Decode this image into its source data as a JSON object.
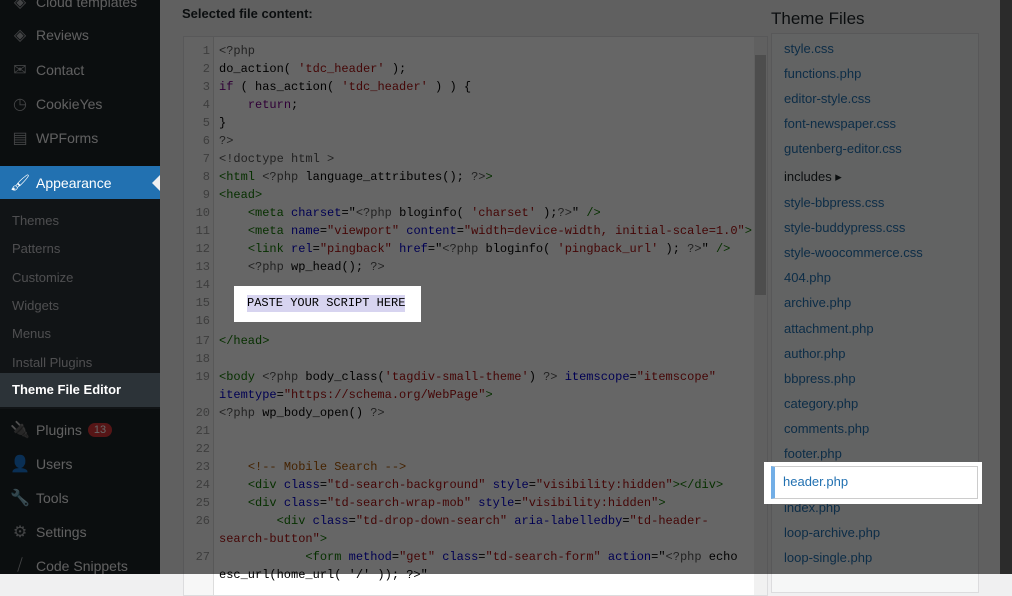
{
  "sidebar": {
    "items": [
      {
        "label": "Cloud templates",
        "icon": "cloud-templates-icon",
        "glyph": "◈"
      },
      {
        "label": "Reviews",
        "icon": "reviews-icon",
        "glyph": "◈"
      },
      {
        "label": "Contact",
        "icon": "mail-icon",
        "glyph": "✉"
      },
      {
        "label": "CookieYes",
        "icon": "cookie-icon",
        "glyph": "◷"
      },
      {
        "label": "WPForms",
        "icon": "forms-icon",
        "glyph": "▤"
      }
    ],
    "appearance": {
      "label": "Appearance",
      "glyph": "🖌"
    },
    "submenu": [
      "Themes",
      "Patterns",
      "Customize",
      "Widgets",
      "Menus",
      "Install Plugins"
    ],
    "active_sub": "Theme File Editor",
    "bottom": [
      {
        "label": "Plugins",
        "icon": "plugins-icon",
        "glyph": "🔌",
        "badge": "13"
      },
      {
        "label": "Users",
        "icon": "users-icon",
        "glyph": "👤"
      },
      {
        "label": "Tools",
        "icon": "tools-icon",
        "glyph": "🔧"
      },
      {
        "label": "Settings",
        "icon": "settings-icon",
        "glyph": "⚙"
      },
      {
        "label": "Code Snippets",
        "icon": "code-snippets-icon",
        "glyph": "⧸"
      }
    ]
  },
  "editor": {
    "label": "Selected file content:",
    "highlight": "PASTE YOUR SCRIPT HERE",
    "lines": [
      [
        [
          "<?php",
          "meta"
        ]
      ],
      [
        [
          "do_action( ",
          ""
        ],
        [
          "'tdc_header'",
          "str"
        ],
        [
          " );",
          ""
        ]
      ],
      [
        [
          "if",
          "kw"
        ],
        [
          " ( has_action( ",
          ""
        ],
        [
          "'tdc_header'",
          "str"
        ],
        [
          " ) ) {",
          ""
        ]
      ],
      [
        [
          "    ",
          ""
        ],
        [
          "return",
          "kw"
        ],
        [
          ";",
          ""
        ]
      ],
      [
        [
          "}",
          ""
        ]
      ],
      [
        [
          "?>",
          "meta"
        ]
      ],
      [
        [
          "<!doctype html >",
          "meta"
        ]
      ],
      [
        [
          "<html ",
          "tag"
        ],
        [
          "<?php",
          "meta"
        ],
        [
          " language_attributes(); ",
          ""
        ],
        [
          "?>",
          "meta"
        ],
        [
          ">",
          "tag"
        ]
      ],
      [
        [
          "<head>",
          "tag"
        ]
      ],
      [
        [
          "    ",
          ""
        ],
        [
          "<meta ",
          "tag"
        ],
        [
          "charset",
          "att"
        ],
        [
          "=\"",
          ""
        ],
        [
          "<?php",
          "meta"
        ],
        [
          " bloginfo( ",
          ""
        ],
        [
          "'charset'",
          "str"
        ],
        [
          " );",
          ""
        ],
        [
          "?>",
          "meta"
        ],
        [
          "\" ",
          ""
        ],
        [
          "/>",
          "tag"
        ]
      ],
      [
        [
          "    ",
          ""
        ],
        [
          "<meta ",
          "tag"
        ],
        [
          "name",
          "att"
        ],
        [
          "=",
          ""
        ],
        [
          "\"viewport\"",
          "str"
        ],
        [
          " ",
          ""
        ],
        [
          "content",
          "att"
        ],
        [
          "=",
          ""
        ],
        [
          "\"width=device-width, initial-scale=1.0\"",
          "str"
        ],
        [
          ">",
          "tag"
        ]
      ],
      [
        [
          "    ",
          ""
        ],
        [
          "<link ",
          "tag"
        ],
        [
          "rel",
          "att"
        ],
        [
          "=",
          ""
        ],
        [
          "\"pingback\"",
          "str"
        ],
        [
          " ",
          ""
        ],
        [
          "href",
          "att"
        ],
        [
          "=\"",
          ""
        ],
        [
          "<?php",
          "meta"
        ],
        [
          " bloginfo( ",
          ""
        ],
        [
          "'pingback_url'",
          "str"
        ],
        [
          " ); ",
          ""
        ],
        [
          "?>",
          "meta"
        ],
        [
          "\" ",
          ""
        ],
        [
          "/>",
          "tag"
        ]
      ],
      [
        [
          "    ",
          ""
        ],
        [
          "<?php",
          "meta"
        ],
        [
          " wp_head(); ",
          ""
        ],
        [
          "?>",
          "meta"
        ]
      ],
      [],
      [],
      [],
      [
        [
          "</head>",
          "tag"
        ]
      ],
      [],
      [
        [
          "<body ",
          "tag"
        ],
        [
          "<?php",
          "meta"
        ],
        [
          " body_class(",
          ""
        ],
        [
          "'tagdiv-small-theme'",
          "str"
        ],
        [
          ") ",
          ""
        ],
        [
          "?>",
          "meta"
        ],
        [
          " ",
          ""
        ],
        [
          "itemscope",
          "att"
        ],
        [
          "=",
          ""
        ],
        [
          "\"itemscope\"",
          "str"
        ],
        [
          " ",
          ""
        ],
        [
          "itemtype",
          "att"
        ],
        [
          "=",
          ""
        ],
        [
          "\"https://schema.org/WebPage\"",
          "str"
        ],
        [
          ">",
          "tag"
        ]
      ],
      [
        [
          "<?php",
          "meta"
        ],
        [
          " wp_body_open() ",
          ""
        ],
        [
          "?>",
          "meta"
        ]
      ],
      [],
      [],
      [
        [
          "    ",
          ""
        ],
        [
          "<!-- Mobile Search -->",
          "com"
        ]
      ],
      [
        [
          "    ",
          ""
        ],
        [
          "<div ",
          "tag"
        ],
        [
          "class",
          "att"
        ],
        [
          "=",
          ""
        ],
        [
          "\"td-search-background\"",
          "str"
        ],
        [
          " ",
          ""
        ],
        [
          "style",
          "att"
        ],
        [
          "=",
          ""
        ],
        [
          "\"visibility:hidden\"",
          "str"
        ],
        [
          "></div>",
          "tag"
        ]
      ],
      [
        [
          "    ",
          ""
        ],
        [
          "<div ",
          "tag"
        ],
        [
          "class",
          "att"
        ],
        [
          "=",
          ""
        ],
        [
          "\"td-search-wrap-mob\"",
          "str"
        ],
        [
          " ",
          ""
        ],
        [
          "style",
          "att"
        ],
        [
          "=",
          ""
        ],
        [
          "\"visibility:hidden\"",
          "str"
        ],
        [
          ">",
          "tag"
        ]
      ],
      [
        [
          "        ",
          ""
        ],
        [
          "<div ",
          "tag"
        ],
        [
          "class",
          "att"
        ],
        [
          "=",
          ""
        ],
        [
          "\"td-drop-down-search\"",
          "str"
        ],
        [
          " ",
          ""
        ],
        [
          "aria-labelledby",
          "att"
        ],
        [
          "=",
          ""
        ],
        [
          "\"td-header-search-button\"",
          "str"
        ],
        [
          ">",
          "tag"
        ]
      ],
      [
        [
          "            ",
          ""
        ],
        [
          "<form ",
          "tag"
        ],
        [
          "method",
          "att"
        ],
        [
          "=",
          ""
        ],
        [
          "\"get\"",
          "str"
        ],
        [
          " ",
          ""
        ],
        [
          "class",
          "att"
        ],
        [
          "=",
          ""
        ],
        [
          "\"td-search-form\"",
          "str"
        ],
        [
          " ",
          ""
        ],
        [
          "action",
          "att"
        ],
        [
          "=\"",
          ""
        ],
        [
          "<?php",
          "meta"
        ],
        [
          " echo esc_url(home_url( '/' )); ?>\"",
          ""
        ]
      ]
    ]
  },
  "files": {
    "title": "Theme Files",
    "items": [
      "style.css",
      "functions.php",
      "editor-style.css",
      "font-newspaper.css",
      "gutenberg-editor.css",
      "includes ▸",
      "style-bbpress.css",
      "style-buddypress.css",
      "style-woocommerce.css",
      "404.php",
      "archive.php",
      "attachment.php",
      "author.php",
      "bbpress.php",
      "category.php",
      "comments.php",
      "footer.php",
      "header.php",
      "index.php",
      "loop-archive.php",
      "loop-single.php"
    ],
    "selected": "header.php"
  }
}
